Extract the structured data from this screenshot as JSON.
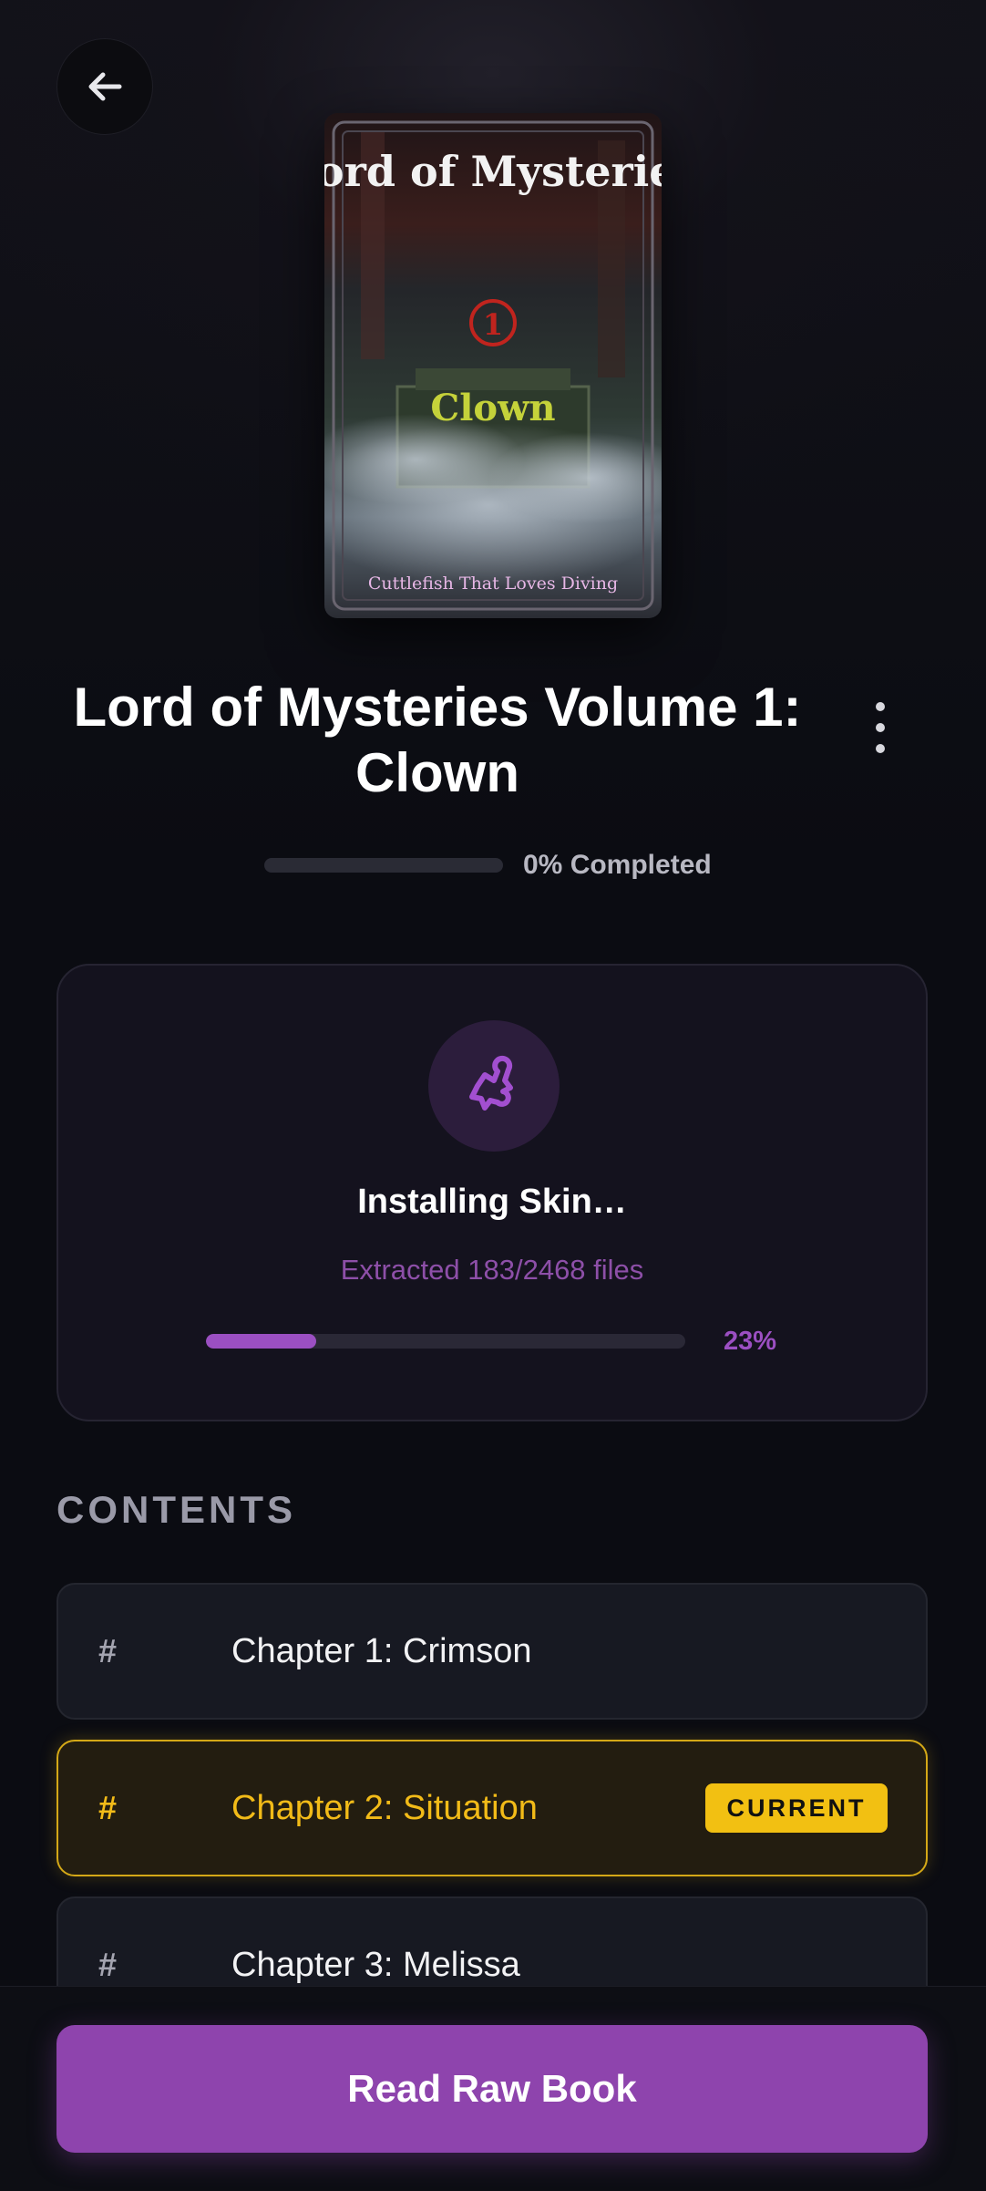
{
  "header": {
    "back_icon": "arrow-left-icon",
    "menu_icon": "more-vertical-icon"
  },
  "cover": {
    "title_art": "Lord of Mysteries",
    "volume_mark": "1",
    "subtitle_art": "Clown",
    "author_art": "Cuttlefish That Loves Diving"
  },
  "book": {
    "title": "Lord of Mysteries Volume 1: Clown",
    "progress_percent": 0,
    "progress_label": "0% Completed"
  },
  "install": {
    "icon": "puzzle-piece-icon",
    "title": "Installing Skin…",
    "status": "Extracted 183/2468 files",
    "percent": 23,
    "percent_label": "23%",
    "accent": "#9b4fc2"
  },
  "contents": {
    "heading": "CONTENTS",
    "chapters": [
      {
        "marker": "#",
        "title": "Chapter 1: Crimson",
        "current": false
      },
      {
        "marker": "#",
        "title": "Chapter 2: Situation",
        "current": true,
        "badge": "CURRENT"
      },
      {
        "marker": "#",
        "title": "Chapter 3: Melissa",
        "current": false
      }
    ]
  },
  "footer": {
    "read_button": "Read Raw Book"
  },
  "colors": {
    "background": "#0b0c12",
    "primary": "#8e44ad",
    "current_highlight": "#f2bb18"
  }
}
